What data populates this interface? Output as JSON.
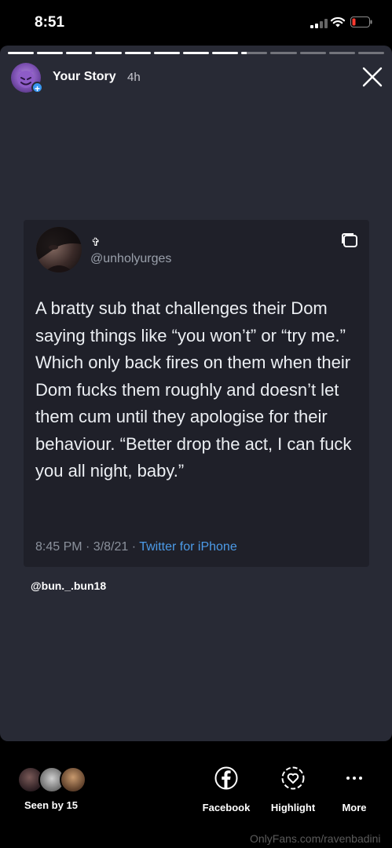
{
  "status_bar": {
    "time": "8:51"
  },
  "story": {
    "progress": {
      "segments": 13,
      "completed": 8,
      "current_fraction": 0.2
    },
    "user_label": "Your Story",
    "age": "4h",
    "icons": {
      "avatar": "devil-emoji-avatar",
      "add": "plus-icon",
      "close": "close-icon"
    }
  },
  "tweet": {
    "display_name": "✞",
    "handle": "@unholyurges",
    "text": "A bratty sub that challenges their Dom saying things like “you won’t” or “try me.” Which only back fires on them when their Dom fucks them roughly and doesn’t let them cum until they apologise for their behaviour. “Better drop the act, I can fuck you all night, baby.”",
    "meta_time": "8:45 PM · 3/8/21 · ",
    "meta_source": "Twitter for iPhone",
    "accent": "#4c9be8"
  },
  "mention": "@bun._.bun18",
  "bottom_bar": {
    "seen_by": "Seen by 15",
    "actions": [
      {
        "label": "Facebook",
        "icon": "facebook-icon"
      },
      {
        "label": "Highlight",
        "icon": "highlight-heart-icon"
      },
      {
        "label": "More",
        "icon": "more-dots-icon"
      }
    ]
  },
  "watermark": "OnlyFans.com/ravenbadini"
}
